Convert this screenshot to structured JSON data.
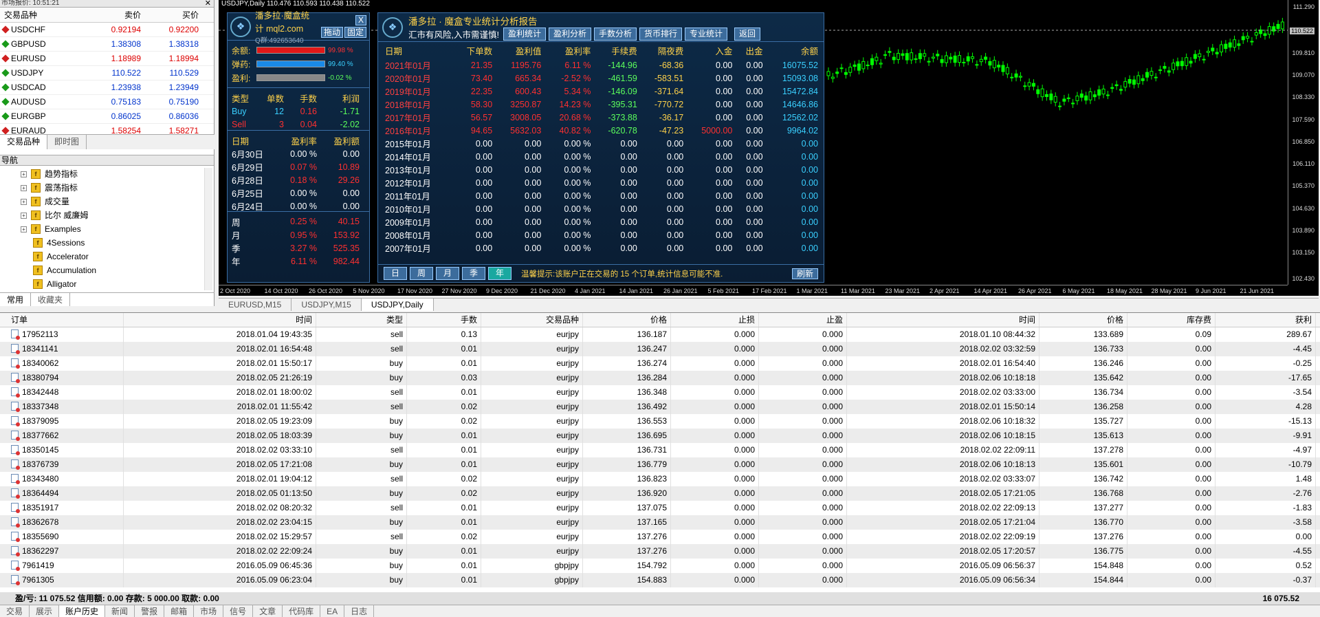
{
  "market_watch": {
    "title": "市场报价: 10:51:21",
    "headers": [
      "交易品种",
      "卖价",
      "买价"
    ],
    "rows": [
      {
        "symbol": "USDCHF",
        "bid": "0.92194",
        "ask": "0.92200",
        "dir": "down"
      },
      {
        "symbol": "GBPUSD",
        "bid": "1.38308",
        "ask": "1.38318",
        "dir": "up"
      },
      {
        "symbol": "EURUSD",
        "bid": "1.18989",
        "ask": "1.18994",
        "dir": "down"
      },
      {
        "symbol": "USDJPY",
        "bid": "110.522",
        "ask": "110.529",
        "dir": "up"
      },
      {
        "symbol": "USDCAD",
        "bid": "1.23938",
        "ask": "1.23949",
        "dir": "up"
      },
      {
        "symbol": "AUDUSD",
        "bid": "0.75183",
        "ask": "0.75190",
        "dir": "up"
      },
      {
        "symbol": "EURGBP",
        "bid": "0.86025",
        "ask": "0.86036",
        "dir": "up"
      },
      {
        "symbol": "EURAUD",
        "bid": "1.58254",
        "ask": "1.58271",
        "dir": "down"
      }
    ],
    "tabs": [
      "交易品种",
      "即时图"
    ]
  },
  "navigator": {
    "title": "导航",
    "items": [
      "趋势指标",
      "震荡指标",
      "成交量",
      "比尔 威廉姆",
      "Examples",
      "4Sessions",
      "Accelerator",
      "Accumulation",
      "Alligator"
    ],
    "tabs": [
      "常用",
      "收藏夹"
    ]
  },
  "chart": {
    "info": "USDJPY,Daily  110.476 110.593 110.438 110.522",
    "prices": [
      "111.290",
      "110.522",
      "109.810",
      "109.070",
      "108.330",
      "107.590",
      "106.850",
      "106.110",
      "105.370",
      "104.630",
      "103.890",
      "103.150",
      "102.430"
    ],
    "dates": [
      "2 Oct 2020",
      "14 Oct 2020",
      "26 Oct 2020",
      "5 Nov 2020",
      "17 Nov 2020",
      "27 Nov 2020",
      "9 Dec 2020",
      "21 Dec 2020",
      "4 Jan 2021",
      "14 Jan 2021",
      "26 Jan 2021",
      "5 Feb 2021",
      "17 Feb 2021",
      "1 Mar 2021",
      "11 Mar 2021",
      "23 Mar 2021",
      "2 Apr 2021",
      "14 Apr 2021",
      "26 Apr 2021",
      "6 May 2021",
      "18 May 2021",
      "28 May 2021",
      "9 Jun 2021",
      "21 Jun 2021"
    ]
  },
  "left_panel": {
    "title": "潘多拉·魔盒统计 mql2.com",
    "group": "Q群:492653640",
    "close": "X",
    "btn_drag": "拖动",
    "btn_fix": "固定",
    "balance_label": "余额:",
    "balance_pct": "99.98 %",
    "margin_label": "弹药:",
    "margin_pct": "99.40 %",
    "profit_label": "盈利:",
    "profit_pct": "-0.02 %",
    "pos_headers": [
      "类型",
      "单数",
      "手数",
      "利润"
    ],
    "positions": [
      {
        "type": "Buy",
        "count": "12",
        "lots": "0.16",
        "profit": "-1.71"
      },
      {
        "type": "Sell",
        "count": "3",
        "lots": "0.04",
        "profit": "-2.02"
      }
    ],
    "day_headers": [
      "日期",
      "盈利率",
      "盈利额"
    ],
    "days": [
      {
        "d": "6月30日",
        "r": "0.00 %",
        "v": "0.00",
        "c": "wh"
      },
      {
        "d": "6月29日",
        "r": "0.07 %",
        "v": "10.89",
        "c": "red"
      },
      {
        "d": "6月28日",
        "r": "0.18 %",
        "v": "29.26",
        "c": "red"
      },
      {
        "d": "6月25日",
        "r": "0.00 %",
        "v": "0.00",
        "c": "wh"
      },
      {
        "d": "6月24日",
        "r": "0.00 %",
        "v": "0.00",
        "c": "wh"
      }
    ],
    "periods": [
      {
        "p": "周",
        "r": "0.25 %",
        "v": "40.15"
      },
      {
        "p": "月",
        "r": "0.95 %",
        "v": "153.92"
      },
      {
        "p": "季",
        "r": "3.27 %",
        "v": "525.35"
      },
      {
        "p": "年",
        "r": "6.11 %",
        "v": "982.44"
      }
    ]
  },
  "right_panel": {
    "title": "潘多拉 · 魔盒专业统计分析报告",
    "subtitle": "汇市有风险,入市需谨慎!",
    "buttons": [
      "盈利统计",
      "盈利分析",
      "手数分析",
      "货币排行",
      "专业统计",
      "返回"
    ],
    "headers": [
      "日期",
      "下单数",
      "盈利值",
      "盈利率",
      "手续费",
      "隔夜费",
      "入金",
      "出金",
      "余额"
    ],
    "rows": [
      [
        "2021年01月",
        "21.35",
        "1195.76",
        "6.11 %",
        "-144.96",
        "-68.36",
        "0.00",
        "0.00",
        "16075.52"
      ],
      [
        "2020年01月",
        "73.40",
        "665.34",
        "-2.52 %",
        "-461.59",
        "-583.51",
        "0.00",
        "0.00",
        "15093.08"
      ],
      [
        "2019年01月",
        "22.35",
        "600.43",
        "5.34 %",
        "-146.09",
        "-371.64",
        "0.00",
        "0.00",
        "15472.84"
      ],
      [
        "2018年01月",
        "58.30",
        "3250.87",
        "14.23 %",
        "-395.31",
        "-770.72",
        "0.00",
        "0.00",
        "14646.86"
      ],
      [
        "2017年01月",
        "56.57",
        "3008.05",
        "20.68 %",
        "-373.88",
        "-36.17",
        "0.00",
        "0.00",
        "12562.02"
      ],
      [
        "2016年01月",
        "94.65",
        "5632.03",
        "40.82 %",
        "-620.78",
        "-47.23",
        "5000.00",
        "0.00",
        "9964.02"
      ],
      [
        "2015年01月",
        "0.00",
        "0.00",
        "0.00 %",
        "0.00",
        "0.00",
        "0.00",
        "0.00",
        "0.00"
      ],
      [
        "2014年01月",
        "0.00",
        "0.00",
        "0.00 %",
        "0.00",
        "0.00",
        "0.00",
        "0.00",
        "0.00"
      ],
      [
        "2013年01月",
        "0.00",
        "0.00",
        "0.00 %",
        "0.00",
        "0.00",
        "0.00",
        "0.00",
        "0.00"
      ],
      [
        "2012年01月",
        "0.00",
        "0.00",
        "0.00 %",
        "0.00",
        "0.00",
        "0.00",
        "0.00",
        "0.00"
      ],
      [
        "2011年01月",
        "0.00",
        "0.00",
        "0.00 %",
        "0.00",
        "0.00",
        "0.00",
        "0.00",
        "0.00"
      ],
      [
        "2010年01月",
        "0.00",
        "0.00",
        "0.00 %",
        "0.00",
        "0.00",
        "0.00",
        "0.00",
        "0.00"
      ],
      [
        "2009年01月",
        "0.00",
        "0.00",
        "0.00 %",
        "0.00",
        "0.00",
        "0.00",
        "0.00",
        "0.00"
      ],
      [
        "2008年01月",
        "0.00",
        "0.00",
        "0.00 %",
        "0.00",
        "0.00",
        "0.00",
        "0.00",
        "0.00"
      ],
      [
        "2007年01月",
        "0.00",
        "0.00",
        "0.00 %",
        "0.00",
        "0.00",
        "0.00",
        "0.00",
        "0.00"
      ]
    ],
    "period_tabs": [
      "日",
      "周",
      "月",
      "季",
      "年"
    ],
    "notice": "温馨提示:该账户正在交易的 15 个订单,统计信息可能不准.",
    "refresh": "刷新"
  },
  "chart_tabs": [
    "EURUSD,M15",
    "USDJPY,M15",
    "USDJPY,Daily"
  ],
  "terminal": {
    "headers": [
      "订单",
      "时间",
      "类型",
      "手数",
      "交易品种",
      "价格",
      "止损",
      "止盈",
      "时间",
      "价格",
      "库存费",
      "获利"
    ],
    "rows": [
      [
        "17952113",
        "2018.01.04 19:43:35",
        "sell",
        "0.13",
        "eurjpy",
        "136.187",
        "0.000",
        "0.000",
        "2018.01.10 08:44:32",
        "133.689",
        "0.09",
        "289.67"
      ],
      [
        "18341141",
        "2018.02.01 16:54:48",
        "sell",
        "0.01",
        "eurjpy",
        "136.247",
        "0.000",
        "0.000",
        "2018.02.02 03:32:59",
        "136.733",
        "0.00",
        "-4.45"
      ],
      [
        "18340062",
        "2018.02.01 15:50:17",
        "buy",
        "0.01",
        "eurjpy",
        "136.274",
        "0.000",
        "0.000",
        "2018.02.01 16:54:40",
        "136.246",
        "0.00",
        "-0.25"
      ],
      [
        "18380794",
        "2018.02.05 21:26:19",
        "buy",
        "0.03",
        "eurjpy",
        "136.284",
        "0.000",
        "0.000",
        "2018.02.06 10:18:18",
        "135.642",
        "0.00",
        "-17.65"
      ],
      [
        "18342448",
        "2018.02.01 18:00:02",
        "sell",
        "0.01",
        "eurjpy",
        "136.348",
        "0.000",
        "0.000",
        "2018.02.02 03:33:00",
        "136.734",
        "0.00",
        "-3.54"
      ],
      [
        "18337348",
        "2018.02.01 11:55:42",
        "sell",
        "0.02",
        "eurjpy",
        "136.492",
        "0.000",
        "0.000",
        "2018.02.01 15:50:14",
        "136.258",
        "0.00",
        "4.28"
      ],
      [
        "18379095",
        "2018.02.05 19:23:09",
        "buy",
        "0.02",
        "eurjpy",
        "136.553",
        "0.000",
        "0.000",
        "2018.02.06 10:18:32",
        "135.727",
        "0.00",
        "-15.13"
      ],
      [
        "18377662",
        "2018.02.05 18:03:39",
        "buy",
        "0.01",
        "eurjpy",
        "136.695",
        "0.000",
        "0.000",
        "2018.02.06 10:18:15",
        "135.613",
        "0.00",
        "-9.91"
      ],
      [
        "18350145",
        "2018.02.02 03:33:10",
        "sell",
        "0.01",
        "eurjpy",
        "136.731",
        "0.000",
        "0.000",
        "2018.02.02 22:09:11",
        "137.278",
        "0.00",
        "-4.97"
      ],
      [
        "18376739",
        "2018.02.05 17:21:08",
        "buy",
        "0.01",
        "eurjpy",
        "136.779",
        "0.000",
        "0.000",
        "2018.02.06 10:18:13",
        "135.601",
        "0.00",
        "-10.79"
      ],
      [
        "18343480",
        "2018.02.01 19:04:12",
        "sell",
        "0.02",
        "eurjpy",
        "136.823",
        "0.000",
        "0.000",
        "2018.02.02 03:33:07",
        "136.742",
        "0.00",
        "1.48"
      ],
      [
        "18364494",
        "2018.02.05 01:13:50",
        "buy",
        "0.02",
        "eurjpy",
        "136.920",
        "0.000",
        "0.000",
        "2018.02.05 17:21:05",
        "136.768",
        "0.00",
        "-2.76"
      ],
      [
        "18351917",
        "2018.02.02 08:20:32",
        "sell",
        "0.01",
        "eurjpy",
        "137.075",
        "0.000",
        "0.000",
        "2018.02.02 22:09:13",
        "137.277",
        "0.00",
        "-1.83"
      ],
      [
        "18362678",
        "2018.02.02 23:04:15",
        "buy",
        "0.01",
        "eurjpy",
        "137.165",
        "0.000",
        "0.000",
        "2018.02.05 17:21:04",
        "136.770",
        "0.00",
        "-3.58"
      ],
      [
        "18355690",
        "2018.02.02 15:29:57",
        "sell",
        "0.02",
        "eurjpy",
        "137.276",
        "0.000",
        "0.000",
        "2018.02.02 22:09:19",
        "137.276",
        "0.00",
        "0.00"
      ],
      [
        "18362297",
        "2018.02.02 22:09:24",
        "buy",
        "0.01",
        "eurjpy",
        "137.276",
        "0.000",
        "0.000",
        "2018.02.05 17:20:57",
        "136.775",
        "0.00",
        "-4.55"
      ],
      [
        "7961419",
        "2016.05.09 06:45:36",
        "buy",
        "0.01",
        "gbpjpy",
        "154.792",
        "0.000",
        "0.000",
        "2016.05.09 06:56:37",
        "154.848",
        "0.00",
        "0.52"
      ],
      [
        "7961305",
        "2016.05.09 06:23:04",
        "buy",
        "0.01",
        "gbpjpy",
        "154.883",
        "0.000",
        "0.000",
        "2016.05.09 06:56:34",
        "154.844",
        "0.00",
        "-0.37"
      ]
    ],
    "summary": "盈/亏: 11 075.52  信用额: 0.00  存款: 5 000.00  取款: 0.00",
    "summary_total": "16 075.52",
    "tabs": [
      "交易",
      "展示",
      "账户历史",
      "新闻",
      "警报",
      "邮箱",
      "市场",
      "信号",
      "文章",
      "代码库",
      "EA",
      "日志"
    ]
  }
}
